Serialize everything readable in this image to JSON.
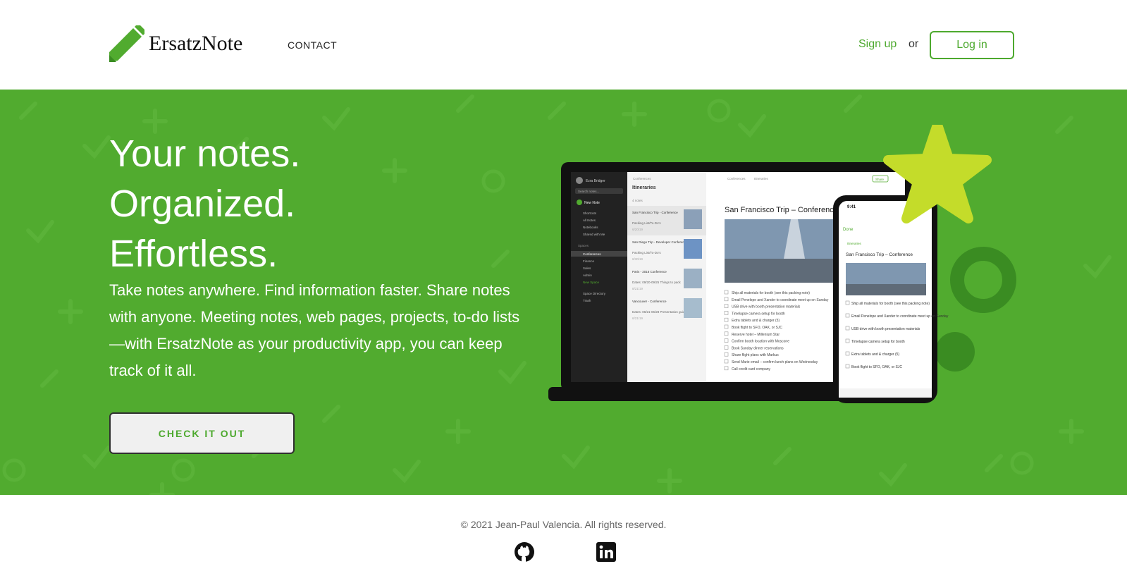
{
  "header": {
    "brand": "ErsatzNote",
    "nav_contact": "CONTACT",
    "signup_label": "Sign up",
    "or_label": "or",
    "login_label": "Log in"
  },
  "hero": {
    "headline": [
      "Your notes.",
      "Organized.",
      "Effortless."
    ],
    "description": "Take notes anywhere. Find information faster. Share notes with anyone. Meeting notes, web pages, projects, to-do lists—with ErsatzNote as your productivity app, you can keep track of it all.",
    "cta_label": "CHECK IT OUT"
  },
  "mockup": {
    "sidebar_user": "Ezra Bridger",
    "sidebar_search": "Search notes...",
    "sidebar_new": "New Note",
    "sidebar_items": [
      "Shortcuts",
      "All Notes",
      "Notebooks",
      "Shared with Me"
    ],
    "spaces_label": "Spaces",
    "spaces": [
      "Conferences",
      "Finance",
      "Sales",
      "Admin",
      "New Space"
    ],
    "sidebar_bottom": [
      "Space Directory",
      "Trash"
    ],
    "list_crumb": "Conferences",
    "list_title": "Itineraries",
    "list_count": "4 notes",
    "notes": [
      {
        "title": "San Francisco Trip - Conference",
        "sub": "Packing List/To-Do's",
        "date": "6/20/19"
      },
      {
        "title": "San Diego Trip - Developer Conference",
        "sub": "Packing List/To-Do's",
        "date": "6/30/19"
      },
      {
        "title": "Paris - 2016 Conference",
        "sub": "Dates: 09/20-09/25 Things to pack",
        "date": "8/21/19"
      },
      {
        "title": "Vancouver - Conference",
        "sub": "Dates: 06/21-06/28 Presentation guidelines",
        "date": "6/21/19"
      }
    ],
    "editor_crumb_a": "Conferences",
    "editor_crumb_b": "Itineraries",
    "editor_share": "Share",
    "editor_title": "San Francisco Trip – Conference",
    "checklist": [
      "Ship all materials for booth (see this packing note)",
      "Email Penelope and Xander to coordinate meet up on Sunday",
      "USB drive with booth presentation materials",
      "Timelapse camera setup for booth",
      "Extra tablets and & charger (5)",
      "Book flight to SFO, OAK, or SJC",
      "Reserve hotel – Millenium Star",
      "Confirm booth location with Moscone",
      "Book Sunday dinner reservations",
      "Share flight plans with Markus",
      "Send Marie email – confirm lunch plans on Wednesday",
      "Call credit card company"
    ],
    "phone_time": "9:41",
    "phone_done": "Done",
    "phone_crumb": "Itineraries",
    "phone_title": "San Francisco Trip – Conference",
    "phone_checklist": [
      "Ship all materials for booth (see this packing note)",
      "Email Penelope and Xander to coordinate meet up on Sunday",
      "USB drive with booth presentation materials",
      "Timelapse camera setup for booth",
      "Extra tablets and & charger (5)",
      "Book flight to SFO, OAK, or SJC"
    ]
  },
  "footer": {
    "copyright": "© 2021 Jean-Paul Valencia. All rights reserved.",
    "social": [
      "github-icon",
      "linkedin-icon"
    ]
  },
  "colors": {
    "brand_green": "#51ab2f",
    "accent_green": "#4da92e",
    "star": "#c4dc2a",
    "dark_green": "#3a8c22"
  }
}
